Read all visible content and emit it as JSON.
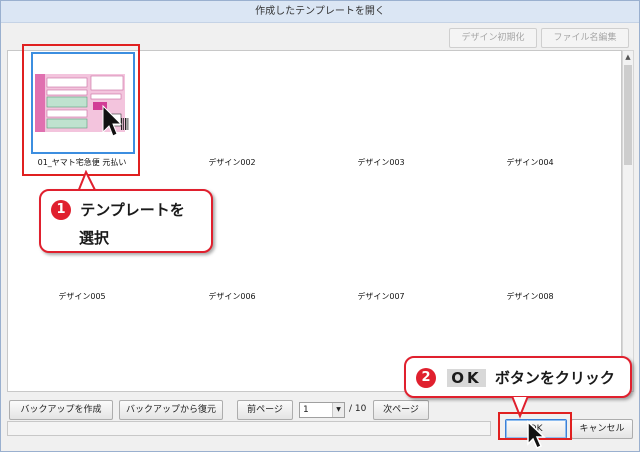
{
  "window": {
    "title": "作成したテンプレートを開く"
  },
  "toolbar": {
    "design_init_label": "デザイン初期化",
    "file_name_edit_label": "ファイル名編集"
  },
  "templates": [
    {
      "label": "01_ヤマト宅急便  元払い",
      "selected": true
    },
    {
      "label": "デザイン002"
    },
    {
      "label": "デザイン003"
    },
    {
      "label": "デザイン004"
    },
    {
      "label": "デザイン005"
    },
    {
      "label": "デザイン006"
    },
    {
      "label": "デザイン007"
    },
    {
      "label": "デザイン008"
    }
  ],
  "bottom": {
    "backup_create_label": "バックアップを作成",
    "backup_restore_label": "バックアップから復元",
    "prev_page_label": "前ページ",
    "page_value": "1",
    "page_total": "/ 10",
    "next_page_label": "次ページ",
    "ok_label": "OK",
    "cancel_label": "キャンセル"
  },
  "callouts": {
    "step1_number": "1",
    "step1_line1": "テンプレートを",
    "step1_line2": "選択",
    "step2_number": "2",
    "step2_ok": "OK",
    "step2_text": "ボタンをクリック"
  },
  "colors": {
    "highlight_red": "#e0202e",
    "selection_blue": "#3c8ee0"
  }
}
